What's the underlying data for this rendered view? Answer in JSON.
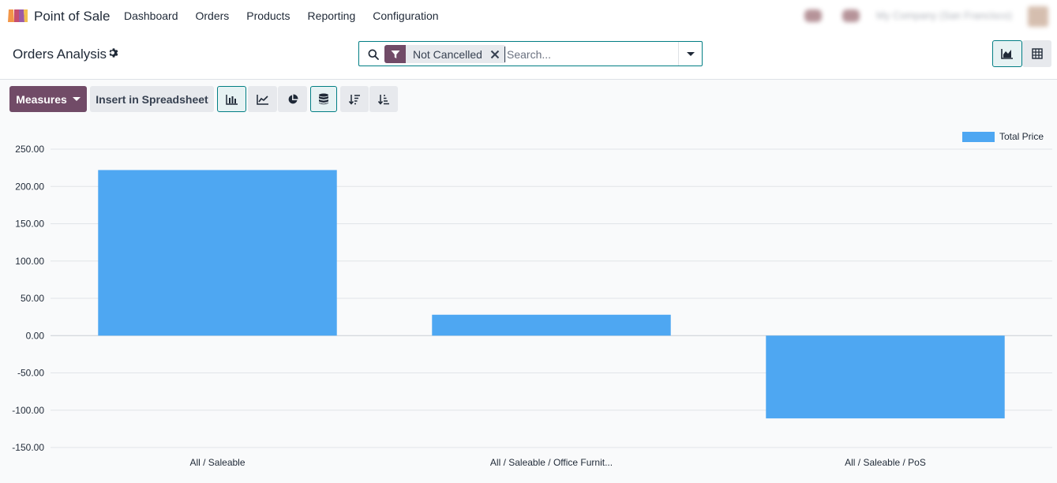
{
  "app": {
    "name": "Point of Sale"
  },
  "menu": [
    "Dashboard",
    "Orders",
    "Products",
    "Reporting",
    "Configuration"
  ],
  "systray": {
    "company": "My Company (San Francisco)"
  },
  "page": {
    "title": "Orders Analysis"
  },
  "search": {
    "facet": "Not Cancelled",
    "placeholder": "Search..."
  },
  "toolbar": {
    "measures_label": "Measures",
    "spreadsheet_label": "Insert in Spreadsheet"
  },
  "colors": {
    "accent": "#714b67",
    "teal": "#017e84",
    "bar": "#4ea7f2"
  },
  "chart_data": {
    "type": "bar",
    "categories": [
      "All / Saleable",
      "All / Saleable / Office Furnit...",
      "All / Saleable / PoS"
    ],
    "series": [
      {
        "name": "Total Price",
        "values": [
          222,
          28,
          -111
        ]
      }
    ],
    "yticks": [
      "250.00",
      "200.00",
      "150.00",
      "100.00",
      "50.00",
      "0.00",
      "-50.00",
      "-100.00",
      "-150.00"
    ],
    "ylim": [
      -150,
      250
    ],
    "grid": true,
    "legend": "top-right"
  }
}
